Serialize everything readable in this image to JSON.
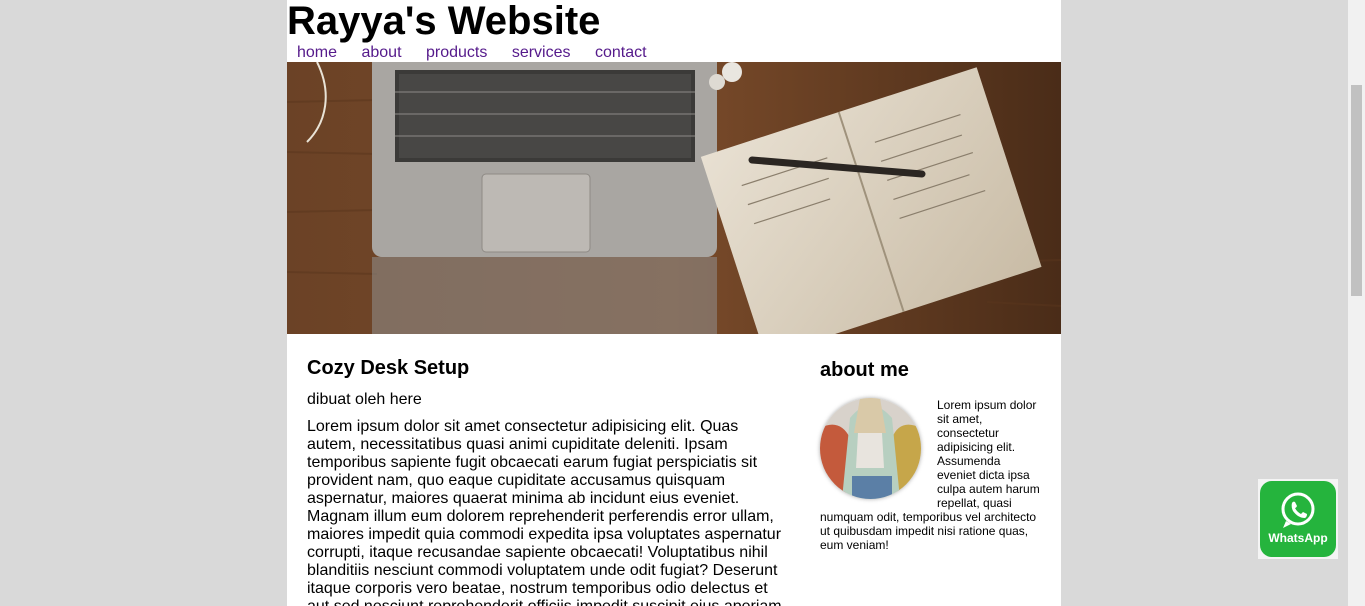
{
  "header": {
    "title": "Rayya's Website"
  },
  "nav": [
    "home",
    "about",
    "products",
    "services",
    "contact"
  ],
  "post": {
    "title": "Cozy Desk Setup",
    "meta": "dibuat oleh here",
    "body": "Lorem ipsum dolor sit amet consectetur adipisicing elit. Quas autem, necessitatibus quasi animi cupiditate deleniti. Ipsam temporibus sapiente fugit obcaecati earum fugiat perspiciatis sit provident nam, quo eaque cupiditate accusamus quisquam aspernatur, maiores quaerat minima ab incidunt eius eveniet. Magnam illum eum dolorem reprehenderit perferendis error ullam, maiores impedit quia commodi expedita ipsa voluptates aspernatur corrupti, itaque recusandae sapiente obcaecati! Voluptatibus nihil blanditiis nesciunt commodi voluptatem unde odit fugiat? Deserunt itaque corporis vero beatae, nostrum temporibus odio delectus et aut sed nesciunt reprehenderit officiis impedit suscipit eius aperiam."
  },
  "aside": {
    "title": "about me",
    "body": "Lorem ipsum dolor sit amet, consectetur adipisicing elit. Assumenda eveniet dicta ipsa culpa autem harum repellat, quasi numquam odit, temporibus vel architecto ut quibusdam impedit nisi ratione quas, eum veniam!"
  },
  "whatsapp": {
    "label": "WhatsApp"
  },
  "icons": {
    "hero": "laptop-notebook-photo",
    "avatar": "profile-photo",
    "whatsapp": "whatsapp-icon"
  }
}
